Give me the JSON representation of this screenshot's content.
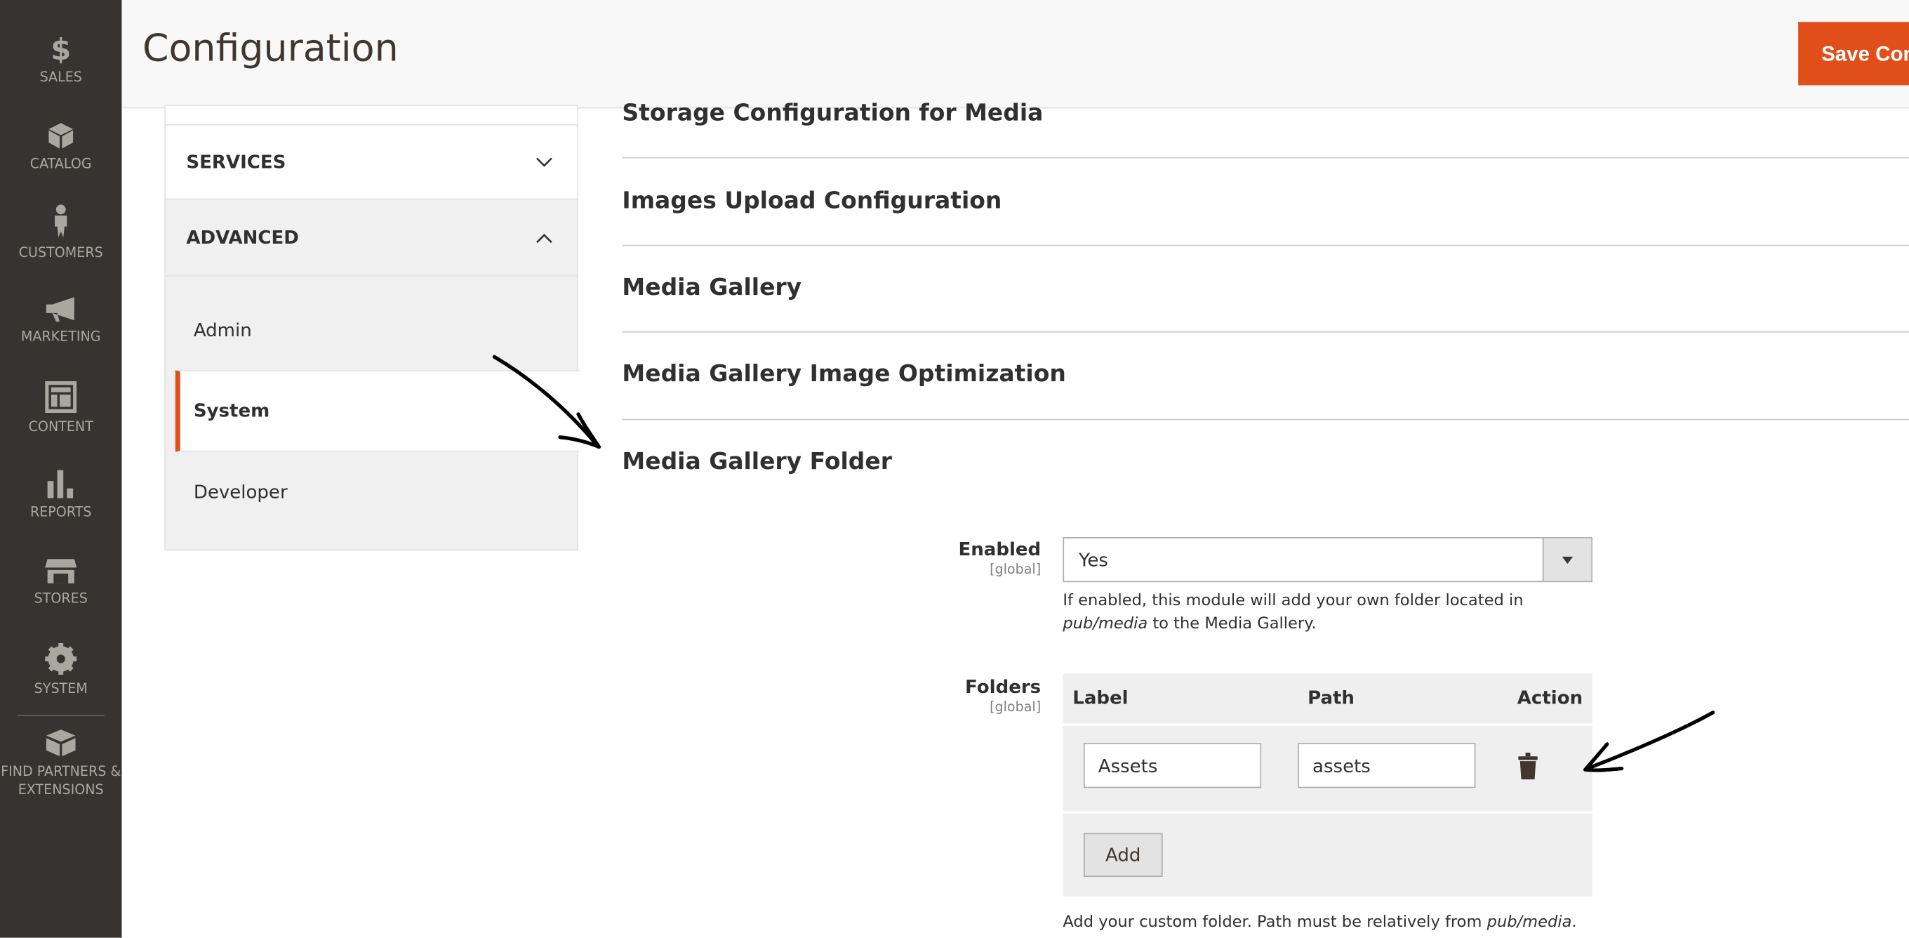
{
  "nav": {
    "items": [
      {
        "label": "SALES",
        "icon": "dollar-icon"
      },
      {
        "label": "CATALOG",
        "icon": "box-icon"
      },
      {
        "label": "CUSTOMERS",
        "icon": "person-icon"
      },
      {
        "label": "MARKETING",
        "icon": "megaphone-icon"
      },
      {
        "label": "CONTENT",
        "icon": "layout-icon"
      },
      {
        "label": "REPORTS",
        "icon": "bar-chart-icon"
      },
      {
        "label": "STORES",
        "icon": "store-icon"
      },
      {
        "label": "SYSTEM",
        "icon": "gear-icon"
      },
      {
        "label": "FIND PARTNERS & EXTENSIONS",
        "icon": "blocks-icon"
      }
    ]
  },
  "header": {
    "title": "Configuration",
    "save_label": "Save Config"
  },
  "tabs": {
    "services": "SERVICES",
    "advanced": "ADVANCED",
    "advanced_items": [
      "Admin",
      "System",
      "Developer"
    ],
    "active": "System"
  },
  "sections": [
    "Storage Configuration for Media",
    "Images Upload Configuration",
    "Media Gallery",
    "Media Gallery Image Optimization",
    "Media Gallery Folder"
  ],
  "fields": {
    "enabled": {
      "label": "Enabled",
      "scope": "[global]",
      "value": "Yes",
      "note_pre": "If enabled, this module will add your own folder located in",
      "note_path": "pub/media",
      "note_post": " to the Media Gallery."
    },
    "folders": {
      "label": "Folders",
      "scope": "[global]",
      "columns": [
        "Label",
        "Path",
        "Action"
      ],
      "rows": [
        {
          "label": "Assets",
          "path": "assets"
        }
      ],
      "add_label": "Add",
      "note_pre": "Add your custom folder. Path must be relatively from ",
      "note_path": "pub/media",
      "note_post": "."
    }
  },
  "colors": {
    "accent": "#e04f1a",
    "nav_bg": "#373330"
  }
}
